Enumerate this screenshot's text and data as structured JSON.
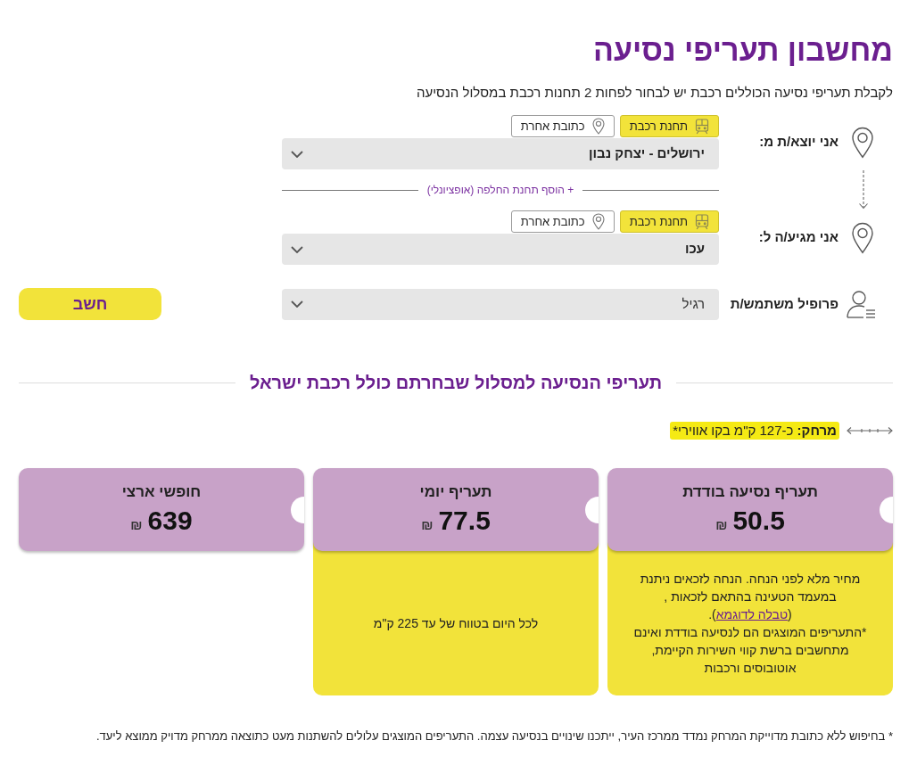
{
  "title": "מחשבון תעריפי נסיעה",
  "subtitle": "לקבלת תעריפי נסיעה הכוללים רכבת יש לבחור לפחות 2 תחנות רכבת במסלול הנסיעה",
  "origin": {
    "label": "אני יוצא/ת מ:",
    "modes": [
      {
        "kind": "train",
        "label": "תחנת רכבת",
        "selected": true
      },
      {
        "kind": "address",
        "label": "כתובת אחרת",
        "selected": false
      }
    ],
    "value": "ירושלים - יצחק נבון"
  },
  "add_stop": "+ הוסף תחנת החלפה (אופציונלי)",
  "destination": {
    "label": "אני מגיע/ה ל:",
    "modes": [
      {
        "kind": "train",
        "label": "תחנת רכבת",
        "selected": true
      },
      {
        "kind": "address",
        "label": "כתובת אחרת",
        "selected": false
      }
    ],
    "value": "עכו"
  },
  "profile": {
    "label": "פרופיל משתמש/ת",
    "value": "רגיל"
  },
  "calculate_button": "חשב",
  "results_heading": "תעריפי הנסיעה למסלול שבחרתם כולל רכבת ישראל",
  "distance": {
    "text": "**מרחק:** כ-127 ק\"מ בקו אווירי*",
    "highlighted": true
  },
  "fare_cards": [
    {
      "title": "תעריף נסיעה בודדת",
      "amount": "50.5",
      "currency": "₪",
      "notes": [
        {
          "kind": "link",
          "before": "מחיר מלא לפני הנחה. הנחה לזכאים ניתנת במעמד הטעינה בהתאם לזכאות , (",
          "link": "טבלה לדוגמא",
          "after": ")."
        },
        {
          "kind": "plain",
          "text": "*התעריפים המוצגים הם לנסיעה בודדת ואינם מתחשבים ברשת קווי השירות הקיימת, אוטובוסים ורכבות"
        }
      ]
    },
    {
      "title": "תעריף יומי",
      "amount": "77.5",
      "currency": "₪",
      "notes": [
        {
          "kind": "plain",
          "text": "לכל היום בטווח של עד 225 ק\"מ"
        }
      ]
    },
    {
      "title": "חופשי ארצי",
      "amount": "639",
      "currency": "₪"
    }
  ],
  "footnote": "* בחיפוש ללא כתובת מדוייקת המרחק נמדד ממרכז העיר, ייתכנו שינויים בנסיעה עצמה. התעריפים המוצגים עלולים להשתנות מעט כתוצאה ממרחק מדויק ממוצא ליעד."
}
